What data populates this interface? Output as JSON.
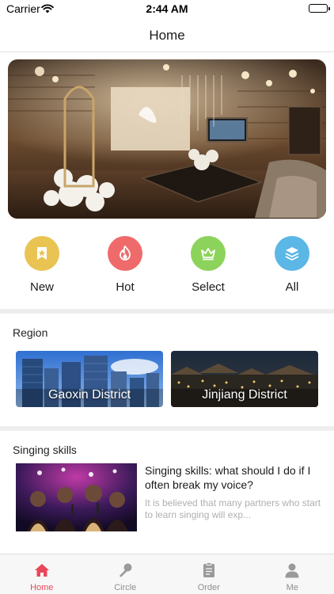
{
  "status_bar": {
    "carrier": "Carrier",
    "time": "2:44 AM"
  },
  "nav": {
    "title": "Home"
  },
  "banner": {
    "image": "ktv-room-interior"
  },
  "categories": [
    {
      "label": "New",
      "icon": "star-bookmark-icon",
      "color": "#E9C453"
    },
    {
      "label": "Hot",
      "icon": "flame-icon",
      "color": "#EF6B6B"
    },
    {
      "label": "Select",
      "icon": "crown-icon",
      "color": "#8CD35B"
    },
    {
      "label": "All",
      "icon": "layers-icon",
      "color": "#5BB7E6"
    }
  ],
  "region": {
    "title": "Region",
    "items": [
      {
        "name": "Gaoxin District"
      },
      {
        "name": "Jinjiang District"
      }
    ]
  },
  "singing": {
    "title": "Singing skills",
    "articles": [
      {
        "title": "Singing skills: what should I do if I often break my voice?",
        "summary": "It is believed that many partners who start to learn singing will exp..."
      }
    ]
  },
  "tabs": [
    {
      "label": "Home",
      "icon": "home-icon",
      "active": true
    },
    {
      "label": "Circle",
      "icon": "microphone-icon",
      "active": false
    },
    {
      "label": "Order",
      "icon": "clipboard-icon",
      "active": false
    },
    {
      "label": "Me",
      "icon": "person-icon",
      "active": false
    }
  ],
  "colors": {
    "accent": "#E8485A",
    "tab_inactive": "#8E8E8E",
    "divider": "#EEEEEE"
  }
}
